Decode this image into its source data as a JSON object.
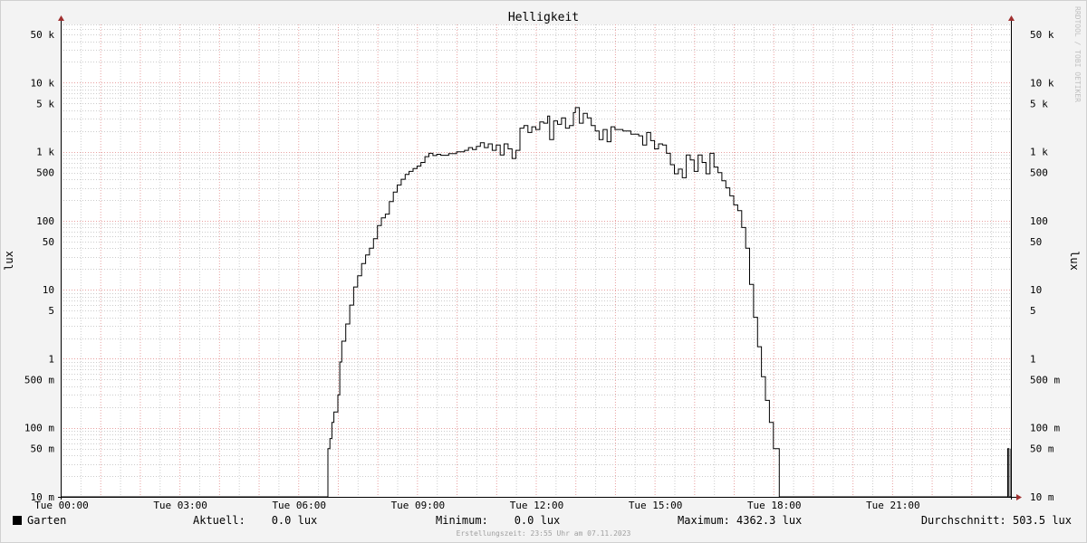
{
  "chart_data": {
    "type": "line",
    "title": "Helligkeit",
    "ylabel_left": "lux",
    "ylabel_right": "lux",
    "watermark": "RRDTOOL / TOBI OETIKER",
    "scale": "log",
    "ylim": [
      0.01,
      70000
    ],
    "xlim_hours": [
      0,
      24
    ],
    "x_ticks": [
      {
        "hour": 0,
        "label": "Tue 00:00"
      },
      {
        "hour": 3,
        "label": "Tue 03:00"
      },
      {
        "hour": 6,
        "label": "Tue 06:00"
      },
      {
        "hour": 9,
        "label": "Tue 09:00"
      },
      {
        "hour": 12,
        "label": "Tue 12:00"
      },
      {
        "hour": 15,
        "label": "Tue 15:00"
      },
      {
        "hour": 18,
        "label": "Tue 18:00"
      },
      {
        "hour": 21,
        "label": "Tue 21:00"
      }
    ],
    "y_ticks": [
      {
        "value": 50000,
        "label": "50 k"
      },
      {
        "value": 10000,
        "label": "10 k"
      },
      {
        "value": 5000,
        "label": "5 k"
      },
      {
        "value": 1000,
        "label": "1 k"
      },
      {
        "value": 500,
        "label": "500"
      },
      {
        "value": 100,
        "label": "100"
      },
      {
        "value": 50,
        "label": "50"
      },
      {
        "value": 10,
        "label": "10"
      },
      {
        "value": 5,
        "label": "5"
      },
      {
        "value": 1,
        "label": "1"
      },
      {
        "value": 0.5,
        "label": "500 m"
      },
      {
        "value": 0.1,
        "label": "100 m"
      },
      {
        "value": 0.05,
        "label": "50 m"
      },
      {
        "value": 0.01,
        "label": "10 m"
      }
    ],
    "series": [
      {
        "name": "Garten",
        "color": "#000000",
        "points": [
          [
            0,
            0.01
          ],
          [
            6.7,
            0.01
          ],
          [
            6.75,
            0.05
          ],
          [
            6.8,
            0.07
          ],
          [
            6.85,
            0.12
          ],
          [
            6.9,
            0.17
          ],
          [
            7.0,
            0.3
          ],
          [
            7.05,
            0.9
          ],
          [
            7.1,
            1.8
          ],
          [
            7.2,
            3.2
          ],
          [
            7.3,
            6
          ],
          [
            7.4,
            11
          ],
          [
            7.5,
            16
          ],
          [
            7.6,
            24
          ],
          [
            7.7,
            32
          ],
          [
            7.8,
            40
          ],
          [
            7.9,
            55
          ],
          [
            8.0,
            85
          ],
          [
            8.1,
            110
          ],
          [
            8.2,
            125
          ],
          [
            8.3,
            190
          ],
          [
            8.4,
            260
          ],
          [
            8.5,
            330
          ],
          [
            8.6,
            400
          ],
          [
            8.7,
            470
          ],
          [
            8.8,
            520
          ],
          [
            8.9,
            570
          ],
          [
            9.0,
            620
          ],
          [
            9.1,
            700
          ],
          [
            9.2,
            850
          ],
          [
            9.3,
            950
          ],
          [
            9.4,
            880
          ],
          [
            9.5,
            920
          ],
          [
            9.6,
            890
          ],
          [
            9.8,
            940
          ],
          [
            10.0,
            1000
          ],
          [
            10.2,
            1050
          ],
          [
            10.3,
            1150
          ],
          [
            10.4,
            1080
          ],
          [
            10.5,
            1200
          ],
          [
            10.6,
            1350
          ],
          [
            10.7,
            1150
          ],
          [
            10.8,
            1300
          ],
          [
            10.9,
            1050
          ],
          [
            11.0,
            1250
          ],
          [
            11.1,
            900
          ],
          [
            11.2,
            1300
          ],
          [
            11.3,
            1100
          ],
          [
            11.4,
            800
          ],
          [
            11.5,
            1050
          ],
          [
            11.6,
            2200
          ],
          [
            11.7,
            2400
          ],
          [
            11.8,
            1900
          ],
          [
            11.9,
            2300
          ],
          [
            12.0,
            2100
          ],
          [
            12.1,
            2700
          ],
          [
            12.2,
            2600
          ],
          [
            12.3,
            3300
          ],
          [
            12.35,
            1500
          ],
          [
            12.45,
            2800
          ],
          [
            12.55,
            2500
          ],
          [
            12.65,
            3100
          ],
          [
            12.75,
            2200
          ],
          [
            12.85,
            2400
          ],
          [
            12.95,
            3700
          ],
          [
            13.0,
            4362.3
          ],
          [
            13.1,
            2600
          ],
          [
            13.2,
            3600
          ],
          [
            13.3,
            3100
          ],
          [
            13.4,
            2400
          ],
          [
            13.5,
            2000
          ],
          [
            13.6,
            1500
          ],
          [
            13.7,
            2100
          ],
          [
            13.8,
            1400
          ],
          [
            13.9,
            2300
          ],
          [
            14.0,
            2100
          ],
          [
            14.2,
            2000
          ],
          [
            14.4,
            1800
          ],
          [
            14.6,
            1700
          ],
          [
            14.7,
            1250
          ],
          [
            14.8,
            1900
          ],
          [
            14.9,
            1450
          ],
          [
            15.0,
            1100
          ],
          [
            15.1,
            1300
          ],
          [
            15.2,
            1250
          ],
          [
            15.3,
            950
          ],
          [
            15.4,
            650
          ],
          [
            15.5,
            480
          ],
          [
            15.6,
            560
          ],
          [
            15.7,
            420
          ],
          [
            15.8,
            900
          ],
          [
            15.9,
            760
          ],
          [
            16.0,
            520
          ],
          [
            16.1,
            900
          ],
          [
            16.2,
            700
          ],
          [
            16.3,
            480
          ],
          [
            16.4,
            950
          ],
          [
            16.5,
            600
          ],
          [
            16.6,
            500
          ],
          [
            16.7,
            380
          ],
          [
            16.8,
            300
          ],
          [
            16.9,
            230
          ],
          [
            17.0,
            170
          ],
          [
            17.1,
            140
          ],
          [
            17.2,
            80
          ],
          [
            17.3,
            40
          ],
          [
            17.4,
            12
          ],
          [
            17.5,
            4
          ],
          [
            17.6,
            1.5
          ],
          [
            17.7,
            0.55
          ],
          [
            17.8,
            0.25
          ],
          [
            17.9,
            0.12
          ],
          [
            18.0,
            0.05
          ],
          [
            18.1,
            0.05
          ],
          [
            18.15,
            0.01
          ],
          [
            23.9,
            0.01
          ],
          [
            23.92,
            0.05
          ],
          [
            23.95,
            0.01
          ],
          [
            24.0,
            0.05
          ]
        ]
      }
    ],
    "legend": {
      "series_label": "Garten",
      "aktuell": "Aktuell:    0.0 lux",
      "minimum": "Minimum:    0.0 lux",
      "maximum": "Maximum: 4362.3 lux",
      "durchschnitt": "Durchschnitt: 503.5 lux"
    },
    "footer": "Erstellungszeit: 23:55 Uhr am 07.11.2023",
    "colors": {
      "background": "#f3f3f3",
      "plot_bg": "#ffffff",
      "major_grid": "#e8a0a0",
      "minor_grid": "#cccccc",
      "line": "#000000",
      "arrow": "#a03030"
    }
  }
}
